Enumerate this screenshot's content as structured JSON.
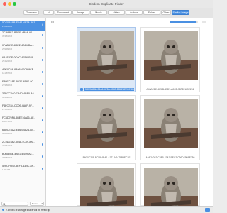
{
  "window": {
    "title": "Cisdem Duplicate Finder"
  },
  "toolbar": {
    "overview_label": "Overview",
    "tabs": [
      {
        "label": "All"
      },
      {
        "label": "Document"
      },
      {
        "label": "Image"
      },
      {
        "label": "Music"
      },
      {
        "label": "Video"
      },
      {
        "label": "Archive"
      },
      {
        "label": "Folder"
      },
      {
        "label": "Other"
      },
      {
        "label": "Similar Image"
      }
    ]
  },
  "sidebar": {
    "items": [
      {
        "name": "5DF0A8AB-E1A1-4F2A-8C1...",
        "sub": "278.16 KB",
        "count": "6"
      },
      {
        "name": "2CB88E3-BBFE-4B84-A0...",
        "sub": "393.81 KB"
      },
      {
        "name": "0FAB67E-8BE2-4B64-BA...",
        "sub": "299.99 KB"
      },
      {
        "name": "6A4F82E-0C6C-4FE6-B29...",
        "sub": "294.22 KB"
      },
      {
        "name": "A9E0C66-8A96-4FC9-9CF...",
        "sub": "181.87 KB"
      },
      {
        "name": "F80EC18E-5D3F-4F8F-8C...",
        "sub": "279.82 KB"
      },
      {
        "name": "37ECC4A0-7B4D-4BF0-A6...",
        "sub": "304.08 KB"
      },
      {
        "name": "F5FCE84-CC09-4A6F-9F...",
        "sub": "275.41 KB"
      },
      {
        "name": "FC6D70F6-5BEE-4A66-AF...",
        "sub": "288.75 KB"
      },
      {
        "name": "65DCE6A2-E56B-4824-B4...",
        "sub": "306.32 KB"
      },
      {
        "name": "2C0D2342-3548-4C09-8A...",
        "sub": "286.61 KB"
      },
      {
        "name": "B0D87BE-4A01-4B49-A4...",
        "sub": "305.50 KB"
      },
      {
        "name": "52FDF6B0-8EF8-43BC-8F...",
        "sub": "1.09 MB"
      }
    ],
    "search_placeholder": "",
    "sort_label": "Name"
  },
  "main": {
    "progress_fraction": 0.95,
    "cards": [
      {
        "label": "5DF0A8AB-E1A1-4F2A-8C63-BB22BE2C0786"
      },
      {
        "label": "A43A7637-8E8B-43D7-A0CE-78F20163E261"
      },
      {
        "label": "B6C0C209-EC55-4EA1-A772-N6478B9EC1F"
      },
      {
        "label": "AAE24267-C88B-47A7-BEC2-C36DF9D9E356"
      },
      {
        "label": ""
      },
      {
        "label": ""
      }
    ]
  },
  "statusbar": {
    "text": "2.89 MB of storage space will be freed up"
  },
  "colors": {
    "accent": "#4a90e2",
    "traffic_red": "#fd5f57",
    "traffic_yellow": "#fdbc2e",
    "traffic_green": "#28c840"
  }
}
